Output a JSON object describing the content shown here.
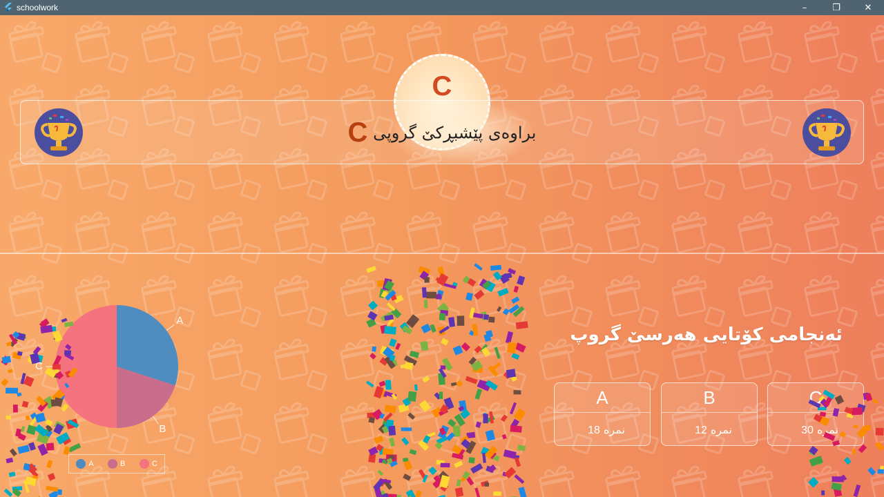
{
  "window": {
    "title": "schoolwork",
    "controls": {
      "minimize": "–",
      "maximize": "❐",
      "close": "✕"
    }
  },
  "winner": {
    "letter": "C",
    "banner_label": "براوەی پێشبڕکێ گروپی",
    "banner_group": "C"
  },
  "results": {
    "title": "ئەنجامی کۆتایی هەرسێ گروپ",
    "groups": [
      {
        "name": "A",
        "score": "18",
        "unit": "نمرە"
      },
      {
        "name": "B",
        "score": "12",
        "unit": "نمرە"
      },
      {
        "name": "C",
        "score": "30",
        "unit": "نمرە"
      }
    ]
  },
  "chart_data": {
    "type": "pie",
    "categories": [
      "A",
      "B",
      "C"
    ],
    "values": [
      18,
      12,
      30
    ],
    "colors": [
      "#4f8cc0",
      "#c86d8c",
      "#f4737f"
    ],
    "legend": [
      "A",
      "B",
      "C"
    ],
    "legend_position": "bottom"
  },
  "colors": {
    "accent": "#d24a20",
    "background_start": "#f8a96a",
    "background_end": "#ee7f5c"
  },
  "icons": {
    "app": "flutter-icon",
    "trophy": "trophy-icon"
  }
}
